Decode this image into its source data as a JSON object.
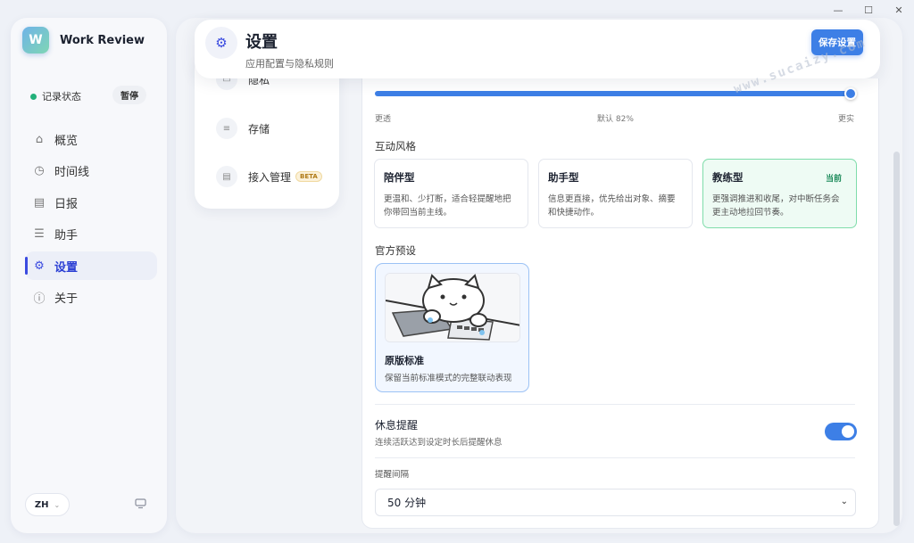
{
  "window": {
    "minimize": "—",
    "maximize": "☐",
    "close": "✕"
  },
  "app": {
    "name": "Work Review",
    "logo_letter": "W"
  },
  "recording": {
    "label": "记录状态",
    "pause_label": "暂停"
  },
  "nav": [
    {
      "icon": "home-icon",
      "glyph": "⌂",
      "label": "概览"
    },
    {
      "icon": "clock-icon",
      "glyph": "◷",
      "label": "时间线"
    },
    {
      "icon": "report-icon",
      "glyph": "▤",
      "label": "日报"
    },
    {
      "icon": "assistant-icon",
      "glyph": "☰",
      "label": "助手"
    },
    {
      "icon": "gear-icon",
      "glyph": "⚙",
      "label": "设置"
    },
    {
      "icon": "info-icon",
      "glyph": "ⓘ",
      "label": "关于"
    }
  ],
  "language": {
    "value": "ZH",
    "chevron": "⌄"
  },
  "header": {
    "title": "设置",
    "subtitle": "应用配置与隐私规则",
    "save_label": "保存设置",
    "icon_glyph": "⚙"
  },
  "sub_menu": [
    {
      "label": "隐私"
    },
    {
      "label": "存储"
    },
    {
      "label": "接入管理",
      "badge": "BETA"
    }
  ],
  "slider": {
    "left_label": "更透",
    "middle_label": "默认 82%",
    "right_label": "更实",
    "value": 1.0
  },
  "interaction_style": {
    "title": "互动风格",
    "options": [
      {
        "name": "陪伴型",
        "desc": "更温和、少打断，适合轻提醒地把你带回当前主线。"
      },
      {
        "name": "助手型",
        "desc": "信息更直接，优先给出对象、摘要和快捷动作。"
      },
      {
        "name": "教练型",
        "desc": "更强调推进和收尾，对中断任务会更主动地拉回节奏。",
        "tag": "当前"
      }
    ]
  },
  "presets": {
    "title": "官方预设",
    "items": [
      {
        "name": "原版标准",
        "desc": "保留当前标准模式的完整联动表现"
      }
    ]
  },
  "rest_reminder": {
    "title": "休息提醒",
    "desc": "连续活跃达到设定时长后提醒休息",
    "enabled": true
  },
  "interval": {
    "label": "提醒间隔",
    "value": "50 分钟",
    "chevron": "⌄"
  },
  "watermark": "www.sucaizy.com",
  "colors": {
    "accent": "#3d7fe6",
    "nav_active": "#3b4be0",
    "current_bg": "#eefbf4",
    "status_green": "#22b07a"
  }
}
